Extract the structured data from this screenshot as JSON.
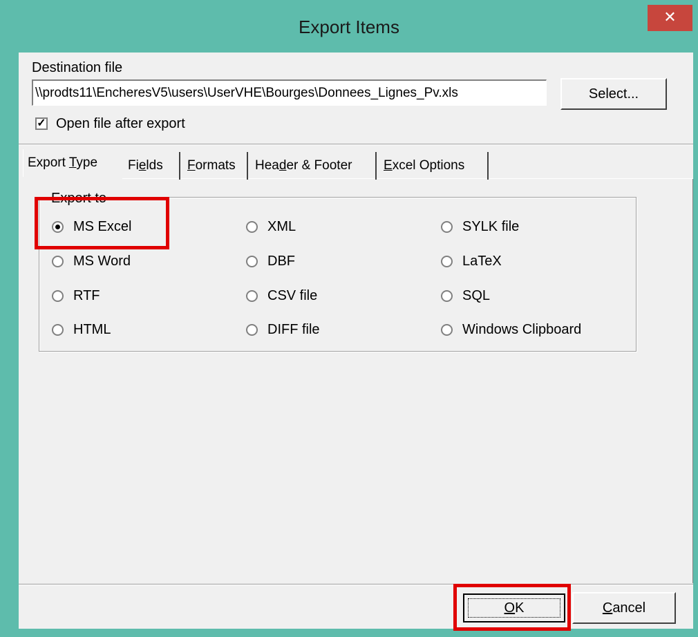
{
  "window": {
    "title": "Export Items",
    "close_glyph": "✕",
    "accent_color": "#5ebcac",
    "close_color": "#c7463d"
  },
  "destination": {
    "label": "Destination file",
    "value": "\\\\prodts11\\EncheresV5\\users\\UserVHE\\Bourges\\Donnees_Lignes_Pv.xls",
    "select_label": "Select...",
    "open_after_label": "Open file after export",
    "open_after_checked": true
  },
  "tabs": [
    {
      "pre": "Export ",
      "u": "T",
      "post": "ype",
      "active": true
    },
    {
      "pre": "Fi",
      "u": "e",
      "post": "lds",
      "active": false
    },
    {
      "pre": "",
      "u": "F",
      "post": "ormats",
      "active": false
    },
    {
      "pre": "Hea",
      "u": "d",
      "post": "er & Footer",
      "active": false
    },
    {
      "pre": "",
      "u": "E",
      "post": "xcel Options",
      "active": false
    }
  ],
  "export_to": {
    "legend": "Export to",
    "options": [
      {
        "label": "MS Excel",
        "selected": true
      },
      {
        "label": "MS Word",
        "selected": false
      },
      {
        "label": "RTF",
        "selected": false
      },
      {
        "label": "HTML",
        "selected": false
      },
      {
        "label": "XML",
        "selected": false
      },
      {
        "label": "DBF",
        "selected": false
      },
      {
        "label": "CSV file",
        "selected": false
      },
      {
        "label": "DIFF file",
        "selected": false
      },
      {
        "label": "SYLK file",
        "selected": false
      },
      {
        "label": "LaTeX",
        "selected": false
      },
      {
        "label": "SQL",
        "selected": false
      },
      {
        "label": "Windows Clipboard",
        "selected": false
      }
    ]
  },
  "buttons": {
    "ok": {
      "u": "O",
      "post": "K"
    },
    "cancel": {
      "u": "C",
      "post": "ancel"
    }
  },
  "highlight_color": "#e00000"
}
